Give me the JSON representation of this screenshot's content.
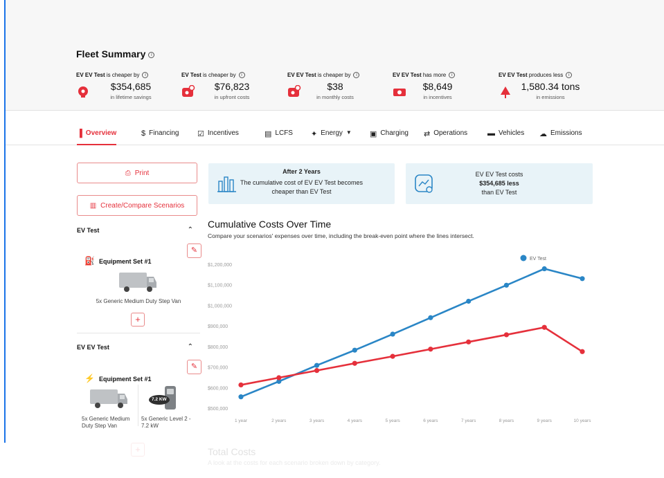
{
  "summary": {
    "title": "Fleet Summary",
    "stats": [
      {
        "subject": "EV EV Test",
        "phrase": "is cheaper by",
        "value": "$354,685",
        "sub": "in lifetime savings"
      },
      {
        "subject": "EV Test",
        "phrase": "is cheaper by",
        "value": "$76,823",
        "sub": "in upfront costs"
      },
      {
        "subject": "EV EV Test",
        "phrase": "is cheaper by",
        "value": "$38",
        "sub": "in monthly costs"
      },
      {
        "subject": "EV EV Test",
        "phrase": "has more",
        "value": "$8,649",
        "sub": "in incentives"
      },
      {
        "subject": "EV EV Test",
        "phrase": "produces less",
        "value": "1,580.34 tons",
        "sub": "in emissions"
      }
    ]
  },
  "tabs": [
    "Overview",
    "Financing",
    "Incentives",
    "LCFS",
    "Energy",
    "Charging",
    "Operations",
    "Vehicles",
    "Emissions"
  ],
  "sidebar": {
    "print_label": "Print",
    "create_label": "Create/Compare Scenarios",
    "scenario1": {
      "name": "EV Test",
      "equipment_title": "Equipment Set #1",
      "vehicle_caption": "5x Generic Medium Duty Step Van"
    },
    "scenario2": {
      "name": "EV EV Test",
      "equipment_title": "Equipment Set #1",
      "vehicle_caption": "5x Generic Medium Duty Step Van",
      "charger_caption": "5x Generic Level 2 - 7.2 kW",
      "charger_badge": "7.2 KW"
    }
  },
  "cards": {
    "breakeven": {
      "title": "After 2 Years",
      "line1": "The cumulative cost of EV EV Test becomes",
      "line2": "cheaper than EV Test"
    },
    "savings": {
      "line1": "EV EV Test costs",
      "amount": "$354,685 less",
      "line2": "than EV Test"
    }
  },
  "chart_title": "Cumulative Costs Over Time",
  "chart_subtitle": "Compare your scenarios' expenses over time, including the break-even point where the lines intersect.",
  "next_section": {
    "title": "Total Costs",
    "subtitle": "A look at the costs for each scenario broken down by category."
  },
  "colors": {
    "accent": "#e5303b",
    "blue_series": "#2a86c6",
    "red_series": "#e5303b",
    "card_bg": "#e8f3f8"
  },
  "chart_data": {
    "type": "line",
    "categories": [
      "1 year",
      "2 years",
      "3 years",
      "4 years",
      "5 years",
      "6 years",
      "7 years",
      "8 years",
      "9 years",
      "10 years"
    ],
    "y_ticks": [
      "$500,000",
      "$600,000",
      "$700,000",
      "$800,000",
      "$900,000",
      "$1,000,000",
      "$1,100,000",
      "$1,200,000"
    ],
    "ylim": [
      500000,
      1200000
    ],
    "series": [
      {
        "name": "EV Test",
        "color": "#2a86c6",
        "values": [
          555000,
          630000,
          708000,
          782000,
          860000,
          940000,
          1020000,
          1098000,
          1178000,
          1130000
        ]
      },
      {
        "name": "",
        "color": "#e5303b",
        "values": [
          613000,
          648000,
          683000,
          718000,
          752000,
          787000,
          822000,
          857000,
          893000,
          775000
        ]
      }
    ],
    "legend_label": "EV Test",
    "legend_position": "top-right",
    "grid": false
  }
}
